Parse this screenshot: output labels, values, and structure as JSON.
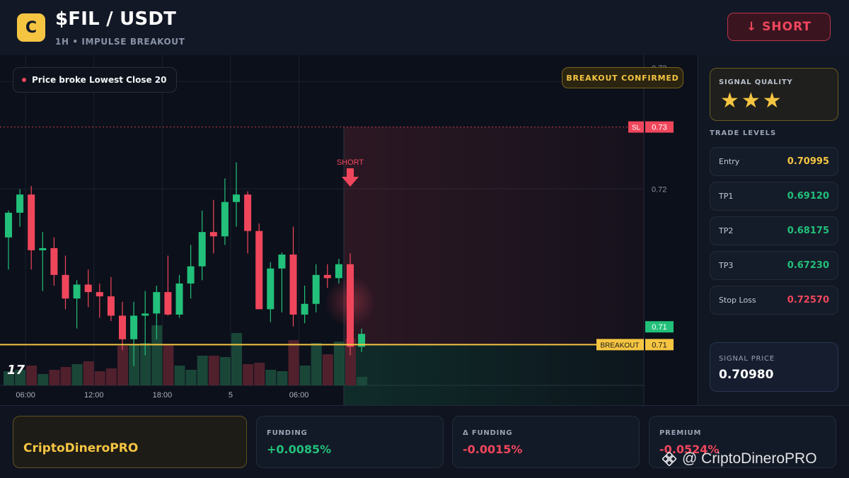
{
  "header": {
    "logo_letter": "C",
    "pair": "$FIL / USDT",
    "subtitle": "1H • IMPULSE BREAKOUT",
    "signal_button": "↓ SHORT"
  },
  "chart_badges": {
    "left": "Price broke Lowest Close 20",
    "right": "BREAKOUT CONFIRMED",
    "tv_logo": "17"
  },
  "colors": {
    "up": "#22c07a",
    "down": "#f0465c",
    "breakout": "#f5c542",
    "accent": "#f5c542"
  },
  "chart_data": {
    "type": "candlestick",
    "x_ticks": [
      "06:00",
      "12:00",
      "18:00",
      "5",
      "06:00"
    ],
    "x_tick_index": [
      1.5,
      7.5,
      13.5,
      19.5,
      25.5
    ],
    "y_ticks": [
      0.73,
      0.72
    ],
    "ylim": [
      0.7015,
      0.7325
    ],
    "candles": [
      {
        "o": 0.7155,
        "h": 0.718,
        "l": 0.7125,
        "c": 0.7178,
        "v": 20
      },
      {
        "o": 0.7178,
        "h": 0.72,
        "l": 0.7165,
        "c": 0.7195,
        "v": 22
      },
      {
        "o": 0.7195,
        "h": 0.7203,
        "l": 0.7125,
        "c": 0.7143,
        "v": 28
      },
      {
        "o": 0.7143,
        "h": 0.716,
        "l": 0.7105,
        "c": 0.7145,
        "v": 16
      },
      {
        "o": 0.7145,
        "h": 0.7155,
        "l": 0.711,
        "c": 0.712,
        "v": 22
      },
      {
        "o": 0.712,
        "h": 0.7138,
        "l": 0.7088,
        "c": 0.7098,
        "v": 26
      },
      {
        "o": 0.7098,
        "h": 0.7115,
        "l": 0.707,
        "c": 0.7111,
        "v": 30
      },
      {
        "o": 0.7111,
        "h": 0.7125,
        "l": 0.709,
        "c": 0.7104,
        "v": 34
      },
      {
        "o": 0.7104,
        "h": 0.7112,
        "l": 0.708,
        "c": 0.71,
        "v": 20
      },
      {
        "o": 0.71,
        "h": 0.7118,
        "l": 0.7077,
        "c": 0.7082,
        "v": 24
      },
      {
        "o": 0.7082,
        "h": 0.7095,
        "l": 0.705,
        "c": 0.706,
        "v": 56
      },
      {
        "o": 0.706,
        "h": 0.7095,
        "l": 0.7035,
        "c": 0.7082,
        "v": 58
      },
      {
        "o": 0.7082,
        "h": 0.7105,
        "l": 0.7045,
        "c": 0.7084,
        "v": 60
      },
      {
        "o": 0.7084,
        "h": 0.711,
        "l": 0.706,
        "c": 0.7104,
        "v": 85
      },
      {
        "o": 0.7104,
        "h": 0.7138,
        "l": 0.7082,
        "c": 0.7083,
        "v": 58
      },
      {
        "o": 0.7083,
        "h": 0.712,
        "l": 0.708,
        "c": 0.7112,
        "v": 28
      },
      {
        "o": 0.7112,
        "h": 0.7148,
        "l": 0.7098,
        "c": 0.7128,
        "v": 22
      },
      {
        "o": 0.7128,
        "h": 0.718,
        "l": 0.7115,
        "c": 0.716,
        "v": 42
      },
      {
        "o": 0.716,
        "h": 0.719,
        "l": 0.714,
        "c": 0.7156,
        "v": 42
      },
      {
        "o": 0.7156,
        "h": 0.721,
        "l": 0.7148,
        "c": 0.7188,
        "v": 40
      },
      {
        "o": 0.7188,
        "h": 0.7225,
        "l": 0.7165,
        "c": 0.7195,
        "v": 74
      },
      {
        "o": 0.7195,
        "h": 0.7198,
        "l": 0.714,
        "c": 0.7161,
        "v": 30
      },
      {
        "o": 0.7161,
        "h": 0.7168,
        "l": 0.709,
        "c": 0.7088,
        "v": 32
      },
      {
        "o": 0.7088,
        "h": 0.7132,
        "l": 0.7076,
        "c": 0.7126,
        "v": 22
      },
      {
        "o": 0.7126,
        "h": 0.7141,
        "l": 0.7085,
        "c": 0.7139,
        "v": 20
      },
      {
        "o": 0.7139,
        "h": 0.7165,
        "l": 0.7072,
        "c": 0.7083,
        "v": 64
      },
      {
        "o": 0.7083,
        "h": 0.711,
        "l": 0.7075,
        "c": 0.7093,
        "v": 28
      },
      {
        "o": 0.7093,
        "h": 0.713,
        "l": 0.7085,
        "c": 0.712,
        "v": 60
      },
      {
        "o": 0.712,
        "h": 0.713,
        "l": 0.7108,
        "c": 0.7117,
        "v": 44
      },
      {
        "o": 0.7117,
        "h": 0.7135,
        "l": 0.7112,
        "c": 0.713,
        "v": 62
      },
      {
        "o": 0.713,
        "h": 0.714,
        "l": 0.7045,
        "c": 0.7053,
        "v": 66
      },
      {
        "o": 0.7053,
        "h": 0.707,
        "l": 0.7048,
        "c": 0.7065,
        "v": 12
      }
    ],
    "levels": {
      "sl": 0.7258,
      "breakout": 0.7055,
      "current": 0.7065
    },
    "tags": {
      "sl_label": "SL",
      "sl_value": "0.73",
      "breakout_label": "BREAKOUT",
      "breakout_value": "0.71",
      "current_value": "0.71",
      "top_value": "0.73"
    },
    "short_marker": {
      "index": 30,
      "label": "SHORT"
    }
  },
  "side": {
    "quality_label": "SIGNAL QUALITY",
    "stars": "★★★",
    "trade_levels_label": "TRADE LEVELS",
    "levels": [
      {
        "label": "Entry",
        "value": "0.70995",
        "color": "#f5c542"
      },
      {
        "label": "TP1",
        "value": "0.69120",
        "color": "#22c07a"
      },
      {
        "label": "TP2",
        "value": "0.68175",
        "color": "#22c07a"
      },
      {
        "label": "TP3",
        "value": "0.67230",
        "color": "#22c07a"
      },
      {
        "label": "Stop Loss",
        "value": "0.72570",
        "color": "#f0465c"
      }
    ],
    "signal_price_label": "SIGNAL PRICE",
    "signal_price": "0.70980"
  },
  "footer": {
    "brand": "CriptoDineroPRO",
    "stats": [
      {
        "label": "FUNDING",
        "value": "+0.0085%",
        "color": "#22c07a"
      },
      {
        "label": "Δ FUNDING",
        "value": "-0.0015%",
        "color": "#f0465c"
      },
      {
        "label": "PREMIUM",
        "value": "-0.0524%",
        "color": "#f0465c"
      }
    ],
    "watermark": "@ CriptoDineroPRO"
  }
}
